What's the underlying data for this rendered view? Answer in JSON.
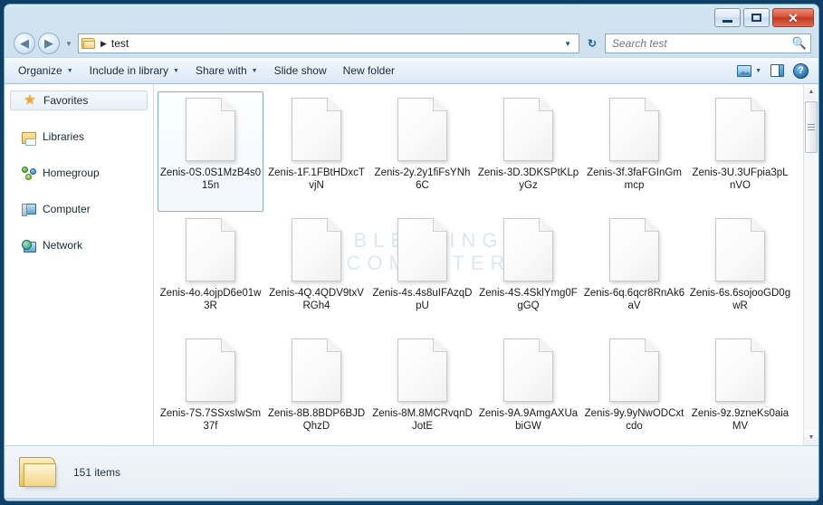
{
  "window": {
    "minimize_label": "Minimize",
    "maximize_label": "Maximize",
    "close_label": "✕"
  },
  "address": {
    "back_glyph": "◀",
    "forward_glyph": "▶",
    "history_glyph": "▼",
    "folder_icon": "folder-icon",
    "separator": "▶",
    "path": "test",
    "dropdown_glyph": "▼",
    "refresh_glyph": "↻"
  },
  "search": {
    "placeholder": "Search test",
    "value": "",
    "icon": "search-icon"
  },
  "commandbar": {
    "items": [
      {
        "label": "Organize",
        "has_caret": true
      },
      {
        "label": "Include in library",
        "has_caret": true
      },
      {
        "label": "Share with",
        "has_caret": true
      },
      {
        "label": "Slide show",
        "has_caret": false
      },
      {
        "label": "New folder",
        "has_caret": false
      }
    ],
    "view_caret": "▼",
    "view_icon": "view-layout-icon",
    "preview_pane_icon": "preview-pane-icon",
    "help_icon": "help-icon",
    "help_glyph": "?"
  },
  "sidebar": {
    "items": [
      {
        "label": "Favorites",
        "icon": "star-icon",
        "selected": true
      },
      {
        "label": "Libraries",
        "icon": "libraries-icon",
        "selected": false
      },
      {
        "label": "Homegroup",
        "icon": "homegroup-icon",
        "selected": false
      },
      {
        "label": "Computer",
        "icon": "computer-icon",
        "selected": false
      },
      {
        "label": "Network",
        "icon": "network-icon",
        "selected": false
      }
    ]
  },
  "watermark": {
    "line1": "BLEEPING",
    "line2": "COMPUTER"
  },
  "files": [
    {
      "name": "Zenis-0S.0S1MzB4s015n",
      "selected": true
    },
    {
      "name": "Zenis-1F.1FBtHDxcTvjN",
      "selected": false
    },
    {
      "name": "Zenis-2y.2y1fiFsYNh6C",
      "selected": false
    },
    {
      "name": "Zenis-3D.3DKSPtKLpyGz",
      "selected": false
    },
    {
      "name": "Zenis-3f.3faFGInGmmcp",
      "selected": false
    },
    {
      "name": "Zenis-3U.3UFpia3pLnVO",
      "selected": false
    },
    {
      "name": "Zenis-4o.4ojpD6e01w3R",
      "selected": false
    },
    {
      "name": "Zenis-4Q.4QDV9txVRGh4",
      "selected": false
    },
    {
      "name": "Zenis-4s.4s8uIFAzqDpU",
      "selected": false
    },
    {
      "name": "Zenis-4S.4SklYmg0FgGQ",
      "selected": false
    },
    {
      "name": "Zenis-6q.6qcr8RnAk6aV",
      "selected": false
    },
    {
      "name": "Zenis-6s.6sojooGD0gwR",
      "selected": false
    },
    {
      "name": "Zenis-7S.7SSxsIwSm37f",
      "selected": false
    },
    {
      "name": "Zenis-8B.8BDP6BJDQhzD",
      "selected": false
    },
    {
      "name": "Zenis-8M.8MCRvqnDJotE",
      "selected": false
    },
    {
      "name": "Zenis-9A.9AmgAXUabiGW",
      "selected": false
    },
    {
      "name": "Zenis-9y.9yNwODCxtcdo",
      "selected": false
    },
    {
      "name": "Zenis-9z.9zneKs0aiaMV",
      "selected": false
    }
  ],
  "scrollbar": {
    "up_glyph": "▲",
    "down_glyph": "▼"
  },
  "statusbar": {
    "folder_icon": "folder-icon",
    "item_count_label": "151 items"
  },
  "colors": {
    "accent": "#2f7ab5",
    "selection_border": "#7aadd4",
    "close_button": "#d8513a",
    "watermark": "#dde7f3"
  }
}
